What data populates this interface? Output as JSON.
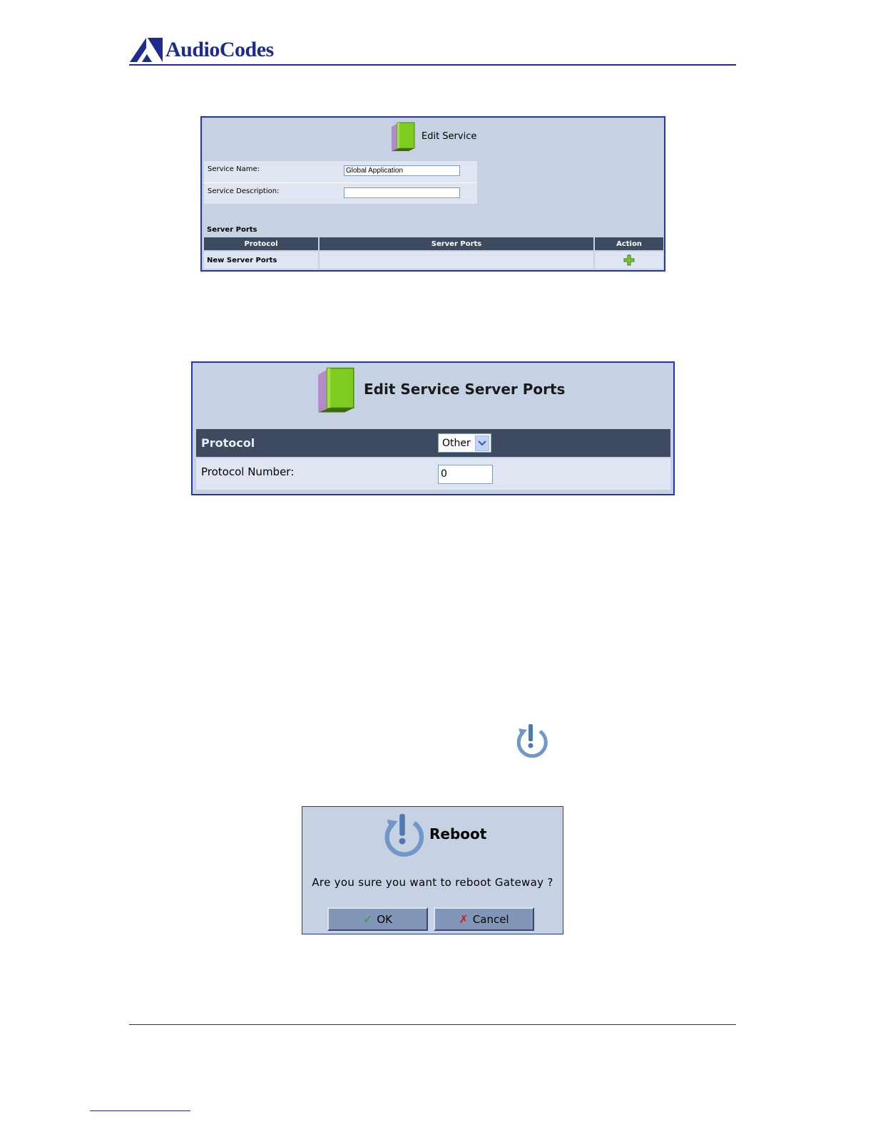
{
  "header": {
    "logo_text": "AudioCodes"
  },
  "edit_service": {
    "title": "Edit Service",
    "service_name_label": "Service Name:",
    "service_name_value": "Global Application",
    "service_description_label": "Service Description:",
    "service_description_value": "",
    "server_ports_heading": "Server Ports",
    "table": {
      "headers": [
        "Protocol",
        "Server Ports",
        "Action"
      ],
      "rows": [
        {
          "protocol": "New Server Ports",
          "server_ports": "",
          "action_icon": "add-icon"
        }
      ]
    }
  },
  "edit_server_ports": {
    "title": "Edit Service Server Ports",
    "protocol_label": "Protocol",
    "protocol_value": "Other",
    "protocol_number_label": "Protocol Number:",
    "protocol_number_value": "0"
  },
  "reboot_dialog": {
    "title": "Reboot",
    "message": "Are you sure you want to reboot Gateway ?",
    "ok_label": "OK",
    "cancel_label": "Cancel"
  },
  "colors": {
    "accent_line": "#1c2b8c",
    "panel_bg": "#c6d2e4",
    "header_row": "#3d4a60",
    "row_bg": "#dfe6f2",
    "button_bg": "#8196b8"
  }
}
